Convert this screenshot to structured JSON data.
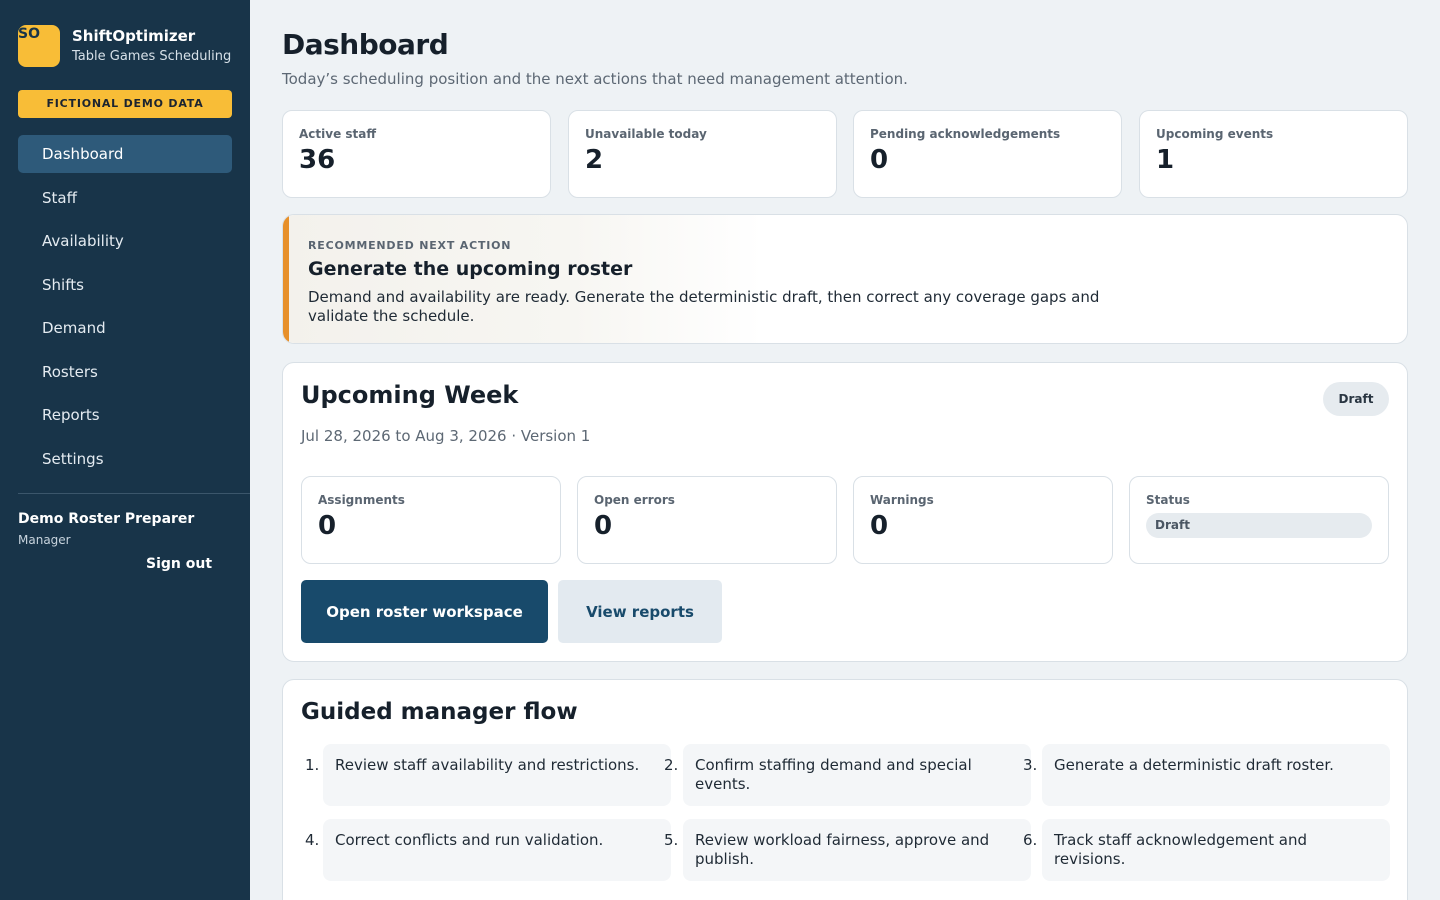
{
  "brand": {
    "initials": "SO",
    "name": "ShiftOptimizer",
    "subtitle": "Table Games Scheduling",
    "accent": "#f8bd37"
  },
  "demo_badge": "FICTIONAL DEMO DATA",
  "nav": {
    "items": [
      {
        "label": "Dashboard",
        "active": true
      },
      {
        "label": "Staff"
      },
      {
        "label": "Availability"
      },
      {
        "label": "Shifts"
      },
      {
        "label": "Demand"
      },
      {
        "label": "Rosters"
      },
      {
        "label": "Reports"
      },
      {
        "label": "Settings"
      }
    ]
  },
  "user": {
    "name": "Demo Roster Preparer",
    "role": "Manager",
    "sign_out": "Sign out"
  },
  "page": {
    "title": "Dashboard",
    "subtitle": "Today’s scheduling position and the next actions that need management attention."
  },
  "stats": [
    {
      "label": "Active staff",
      "value": "36"
    },
    {
      "label": "Unavailable today",
      "value": "2"
    },
    {
      "label": "Pending acknowledgements",
      "value": "0"
    },
    {
      "label": "Upcoming events",
      "value": "1"
    }
  ],
  "recommendation": {
    "kicker": "RECOMMENDED NEXT ACTION",
    "title": "Generate the upcoming roster",
    "body": "Demand and availability are ready. Generate the deterministic draft, then correct any coverage gaps and validate the schedule.",
    "accent": "#e7902a"
  },
  "week": {
    "title": "Upcoming Week",
    "badge": "Draft",
    "subtitle": "Jul 28, 2026 to Aug 3, 2026 · Version 1",
    "metrics": [
      {
        "label": "Assignments",
        "value": "0"
      },
      {
        "label": "Open errors",
        "value": "0"
      },
      {
        "label": "Warnings",
        "value": "0"
      }
    ],
    "status": {
      "label": "Status",
      "value": "Draft"
    },
    "primary_button": "Open roster workspace",
    "secondary_button": "View reports"
  },
  "flow": {
    "title": "Guided manager flow",
    "steps": [
      {
        "num": "1.",
        "text": "Review staff availability and restrictions."
      },
      {
        "num": "2.",
        "text": "Confirm staffing demand and special events."
      },
      {
        "num": "3.",
        "text": "Generate a deterministic draft roster."
      },
      {
        "num": "4.",
        "text": "Correct conflicts and run validation."
      },
      {
        "num": "5.",
        "text": "Review workload fairness, approve and publish."
      },
      {
        "num": "6.",
        "text": "Track staff acknowledgement and revisions."
      }
    ]
  }
}
